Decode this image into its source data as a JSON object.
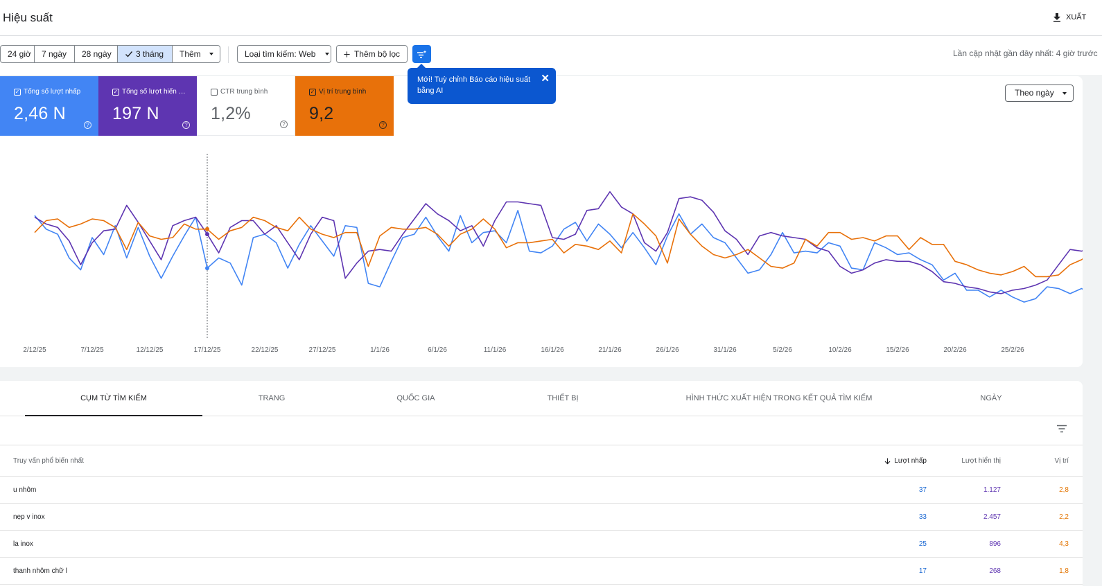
{
  "header": {
    "title": "Hiệu suất",
    "export_label": "XUẤT"
  },
  "filters": {
    "ranges": [
      "24 giờ",
      "7 ngày",
      "28 ngày",
      "3 tháng",
      "Thêm"
    ],
    "active_range": "3 tháng",
    "search_type_label": "Loại tìm kiếm: Web",
    "add_filter_label": "Thêm bộ lọc",
    "last_updated": "Lần cập nhật gần đây nhất: 4 giờ trước"
  },
  "tooltip": {
    "text": "Mới! Tuỳ chỉnh Báo cáo hiệu suất bằng AI"
  },
  "metrics": [
    {
      "label": "Tổng số lượt nhấp",
      "value": "2,46 N",
      "checked": true,
      "color": "#4285f4"
    },
    {
      "label": "Tổng số lượt hiển thị",
      "value": "197 N",
      "checked": true,
      "color": "#5e35b1"
    },
    {
      "label": "CTR trung bình",
      "value": "1,2%",
      "checked": false,
      "color": "#ffffff"
    },
    {
      "label": "Vị trí trung bình",
      "value": "9,2",
      "checked": true,
      "color": "#e8710a"
    }
  ],
  "view_select": "Theo ngày",
  "chart_data": {
    "type": "line",
    "x_tick_labels": [
      "2/12/25",
      "7/12/25",
      "12/12/25",
      "17/12/25",
      "22/12/25",
      "27/12/25",
      "1/1/26",
      "6/1/26",
      "11/1/26",
      "16/1/26",
      "21/1/26",
      "26/1/26",
      "31/1/26",
      "5/2/26",
      "10/2/26",
      "15/2/26",
      "20/2/26",
      "25/2/26"
    ],
    "x_start_day": 0,
    "tick_interval_days": 5,
    "y_min": 0,
    "y_max": 100,
    "hover_day": 15,
    "grid": false,
    "legend": "metric cards above chart",
    "series": [
      {
        "name": "Tổng số lượt nhấp",
        "color": "#4285f4",
        "values": [
          73,
          65,
          62,
          48,
          41,
          60,
          50,
          67,
          48,
          66,
          49,
          36,
          49,
          61,
          72,
          42,
          48,
          45,
          32,
          60,
          62,
          57,
          42,
          56,
          67,
          58,
          49,
          67,
          66,
          33,
          31,
          46,
          60,
          62,
          72,
          61,
          52,
          73,
          57,
          63,
          64,
          57,
          76,
          52,
          51,
          55,
          65,
          69,
          58,
          68,
          62,
          54,
          63,
          54,
          44,
          61,
          74,
          62,
          68,
          60,
          57,
          48,
          39,
          41,
          50,
          63,
          51,
          52,
          51,
          57,
          55,
          42,
          41,
          57,
          54,
          50,
          51,
          47,
          44,
          35,
          39,
          29,
          29,
          25,
          29,
          25,
          22,
          24,
          31,
          30,
          27,
          30,
          25,
          29,
          28,
          32,
          42,
          41,
          34,
          40,
          36,
          43,
          37,
          34,
          41
        ]
      },
      {
        "name": "Tổng số lượt hiển thị",
        "color": "#5e35b1",
        "values": [
          72,
          68,
          66,
          58,
          44,
          57,
          64,
          65,
          79,
          69,
          58,
          47,
          67,
          70,
          72,
          62,
          51,
          66,
          70,
          70,
          62,
          67,
          57,
          47,
          62,
          72,
          70,
          36,
          45,
          52,
          53,
          52,
          62,
          71,
          80,
          74,
          70,
          64,
          67,
          55,
          70,
          81,
          81,
          80,
          79,
          60,
          59,
          62,
          76,
          77,
          87,
          78,
          74,
          57,
          52,
          63,
          83,
          84,
          82,
          75,
          64,
          59,
          50,
          61,
          63,
          61,
          60,
          59,
          54,
          52,
          43,
          39,
          41,
          45,
          47,
          46,
          46,
          44,
          40,
          34,
          33,
          31,
          30,
          28,
          27,
          29,
          30,
          32,
          35,
          44,
          53,
          52,
          55,
          56,
          58,
          63,
          59,
          58,
          52,
          58,
          76
        ]
      },
      {
        "name": "Vị trí trung bình",
        "color": "#e8710a",
        "values": [
          63,
          70,
          71,
          66,
          68,
          71,
          70,
          66,
          53,
          69,
          61,
          59,
          60,
          68,
          65,
          65,
          59,
          64,
          66,
          72,
          70,
          66,
          64,
          72,
          65,
          62,
          60,
          63,
          63,
          43,
          61,
          66,
          65,
          65,
          66,
          62,
          55,
          62,
          65,
          71,
          65,
          54,
          57,
          57,
          58,
          59,
          51,
          56,
          55,
          53,
          58,
          51,
          74,
          68,
          61,
          45,
          71,
          62,
          55,
          50,
          48,
          50,
          53,
          48,
          43,
          42,
          45,
          59,
          55,
          63,
          63,
          59,
          60,
          58,
          61,
          61,
          53,
          60,
          56,
          56,
          46,
          44,
          41,
          39,
          38,
          40,
          43,
          37,
          37,
          38,
          44,
          47,
          52,
          55,
          57,
          60,
          61,
          61,
          55,
          53,
          60,
          64,
          72,
          63,
          58,
          57
        ]
      }
    ]
  },
  "table": {
    "tabs": [
      "CỤM TỪ TÌM KIẾM",
      "TRANG",
      "QUỐC GIA",
      "THIẾT BỊ",
      "HÌNH THỨC XUẤT HIỆN TRONG KẾT QUẢ TÌM KIẾM",
      "NGÀY"
    ],
    "active_tab": 0,
    "columns": {
      "query": "Truy vấn phổ biến nhất",
      "clicks": "Lượt nhấp",
      "impressions": "Lượt hiển thị",
      "position": "Vị trí"
    },
    "rows": [
      {
        "query": "u nhôm",
        "clicks": "37",
        "impressions": "1.127",
        "position": "2,8"
      },
      {
        "query": "nẹp v inox",
        "clicks": "33",
        "impressions": "2.457",
        "position": "2,2"
      },
      {
        "query": "la inox",
        "clicks": "25",
        "impressions": "896",
        "position": "4,3"
      },
      {
        "query": "thanh nhôm chữ l",
        "clicks": "17",
        "impressions": "268",
        "position": "1,8"
      }
    ]
  }
}
